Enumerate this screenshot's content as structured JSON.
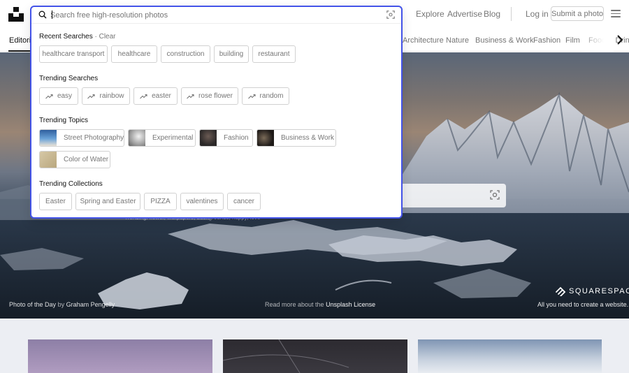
{
  "header": {
    "nav": [
      {
        "label": "Explore"
      },
      {
        "label": "Advertise"
      },
      {
        "label": "Blog"
      }
    ],
    "login": "Log in",
    "submit": "Submit a photo"
  },
  "topics": {
    "active": "Editorial",
    "items": [
      "Architecture",
      "Nature",
      "Business & Work",
      "Fashion",
      "Film",
      "Food & Drink"
    ]
  },
  "search": {
    "value": "",
    "placeholder": "Search free high-resolution photos",
    "recent_title": "Recent Searches",
    "clear_label": "Clear",
    "recent": [
      "healthcare transport",
      "healthcare",
      "construction",
      "building",
      "restaurant"
    ],
    "trending_searches_title": "Trending Searches",
    "trending_searches": [
      "easy",
      "rainbow",
      "easter",
      "rose flower",
      "random"
    ],
    "trending_topics_title": "Trending Topics",
    "trending_topics": [
      {
        "label": "Street Photography",
        "color": "#3d6aa8"
      },
      {
        "label": "Experimental",
        "color": "#bdbdbd"
      },
      {
        "label": "Fashion",
        "color": "#3a3636"
      },
      {
        "label": "Business & Work",
        "color": "#2b2420"
      },
      {
        "label": "Color of Water",
        "color": "#c8b794"
      }
    ],
    "trending_collections_title": "Trending Collections",
    "trending_collections": [
      "Easter",
      "Spring and Easter",
      "PIZZA",
      "valentines",
      "cancer"
    ]
  },
  "hero": {
    "trending_text": "Trending: flower, wallpapers, backgrounds, happy, love",
    "credit_prefix": "Photo of the Day",
    "credit_by": "by",
    "credit_author": "Graham Pengelly",
    "license_prefix": "Read more about the",
    "license_link": "Unsplash License",
    "sponsor": "SQUARESPACE",
    "sponsor_tag": "All you need to create a website."
  },
  "colors": {
    "accent": "#4353e8",
    "muted": "#767676",
    "border": "#d1d1d1"
  }
}
